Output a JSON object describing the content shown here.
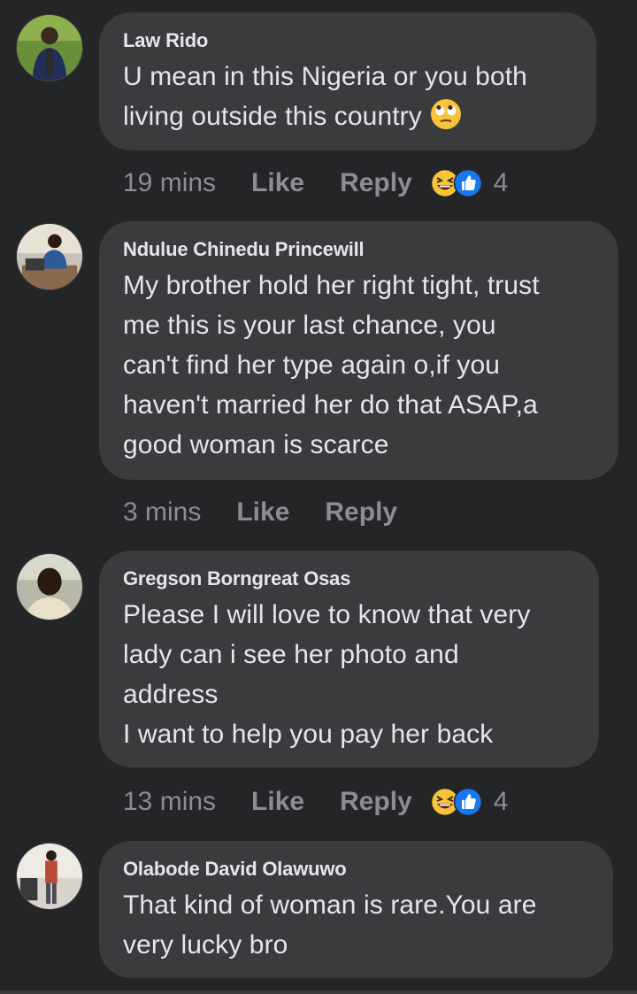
{
  "comments": [
    {
      "author": "Law Rido",
      "lines": [
        "U mean in this Nigeria or you both",
        "living outside this country"
      ],
      "trailing_emoji": "face-with-rolling-eyes-emoji",
      "time": "19 mins",
      "like_label": "Like",
      "reply_label": "Reply",
      "reactions": [
        "laughing-face-reaction",
        "thumbs-up-reaction"
      ],
      "reaction_count": "4"
    },
    {
      "author": "Ndulue Chinedu Princewill",
      "lines": [
        "My brother hold her right tight, trust",
        "me this is your last chance, you",
        "can't find her type again o,if you",
        "haven't married her do that ASAP,a",
        "good woman is scarce"
      ],
      "time": "3 mins",
      "like_label": "Like",
      "reply_label": "Reply"
    },
    {
      "author": "Gregson Borngreat Osas",
      "lines": [
        "Please I will love to know that very",
        "lady can i see her photo and",
        "address",
        "I want to help you pay her back"
      ],
      "time": "13 mins",
      "like_label": "Like",
      "reply_label": "Reply",
      "reactions": [
        "laughing-face-reaction",
        "thumbs-up-reaction"
      ],
      "reaction_count": "4"
    },
    {
      "author": "Olabode David Olawuwo",
      "lines": [
        "That kind of woman is rare.You are",
        "very lucky bro"
      ]
    }
  ],
  "colors": {
    "background": "#242526",
    "bubble": "#3a3b3c",
    "text": "#e4e6eb",
    "muted": "#8a8d91",
    "like_blue": "#1877f2",
    "emoji_yellow": "#f7c33b"
  }
}
